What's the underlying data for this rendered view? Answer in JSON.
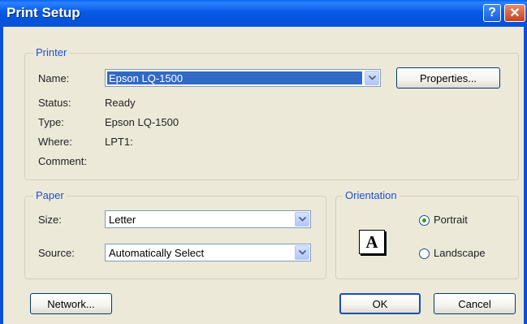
{
  "window": {
    "title": "Print Setup",
    "help_label": "?",
    "close_label": "✕"
  },
  "printer": {
    "legend": "Printer",
    "name_label": "Name:",
    "name_value": "Epson LQ-1500",
    "properties_label": "Properties...",
    "status_label": "Status:",
    "status_value": "Ready",
    "type_label": "Type:",
    "type_value": "Epson LQ-1500",
    "where_label": "Where:",
    "where_value": "LPT1:",
    "comment_label": "Comment:",
    "comment_value": ""
  },
  "paper": {
    "legend": "Paper",
    "size_label": "Size:",
    "size_value": "Letter",
    "source_label": "Source:",
    "source_value": "Automatically Select"
  },
  "orientation": {
    "legend": "Orientation",
    "page_icon_letter": "A",
    "portrait_label": "Portrait",
    "landscape_label": "Landscape",
    "selected": "Portrait"
  },
  "buttons": {
    "network_label": "Network...",
    "ok_label": "OK",
    "cancel_label": "Cancel"
  },
  "icons": {
    "help": "help-icon",
    "close": "close-icon",
    "dropdown": "chevron-down-icon",
    "page": "page-orientation-icon"
  },
  "colors": {
    "titlebar": "#0553dc",
    "legend_text": "#1f4fd1",
    "selection": "#316ac5",
    "dialog_bg": "#ece9d8"
  }
}
